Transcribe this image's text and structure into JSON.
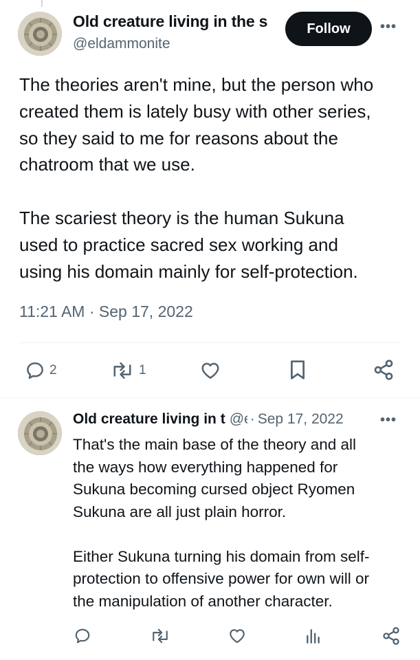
{
  "main_tweet": {
    "author_name": "Old creature living in the s",
    "handle": "@eldammonite",
    "follow_label": "Follow",
    "more_label": "•••",
    "paragraphs": [
      [
        "The theories aren't mine, but the person who",
        "created them is lately busy with other series,",
        "so they said to me for reasons about the",
        "chatroom that we use."
      ],
      [
        "The scariest theory is the human Sukuna",
        "used to practice sacred sex working and",
        "using his domain mainly for self-protection."
      ]
    ],
    "timestamp": "11:21 AM · Sep 17, 2022",
    "actions": {
      "reply_count": "2",
      "retweet_count": "1"
    },
    "icons": [
      "reply-icon",
      "retweet-icon",
      "like-icon",
      "bookmark-icon",
      "share-icon"
    ]
  },
  "reply_tweet": {
    "author_name": "Old creature living in t",
    "handle": "@eldammonite",
    "separator": "·",
    "date": "Sep 17, 2022",
    "more_label": "•••",
    "paragraphs": [
      [
        "That's the main base of the theory and all",
        "the ways how everything happened for",
        "Sukuna becoming cursed object Ryomen",
        "Sukuna are all just plain horror."
      ],
      [
        "Either Sukuna turning his domain from self-",
        "protection to offensive power for own will or",
        "the manipulation of another character."
      ]
    ],
    "icons": [
      "reply-icon",
      "retweet-icon",
      "like-icon",
      "views-icon",
      "share-icon"
    ]
  },
  "colors": {
    "text": "#0f1419",
    "secondary": "#536471",
    "divider": "#eff3f4",
    "follow_bg": "#0f1419"
  }
}
